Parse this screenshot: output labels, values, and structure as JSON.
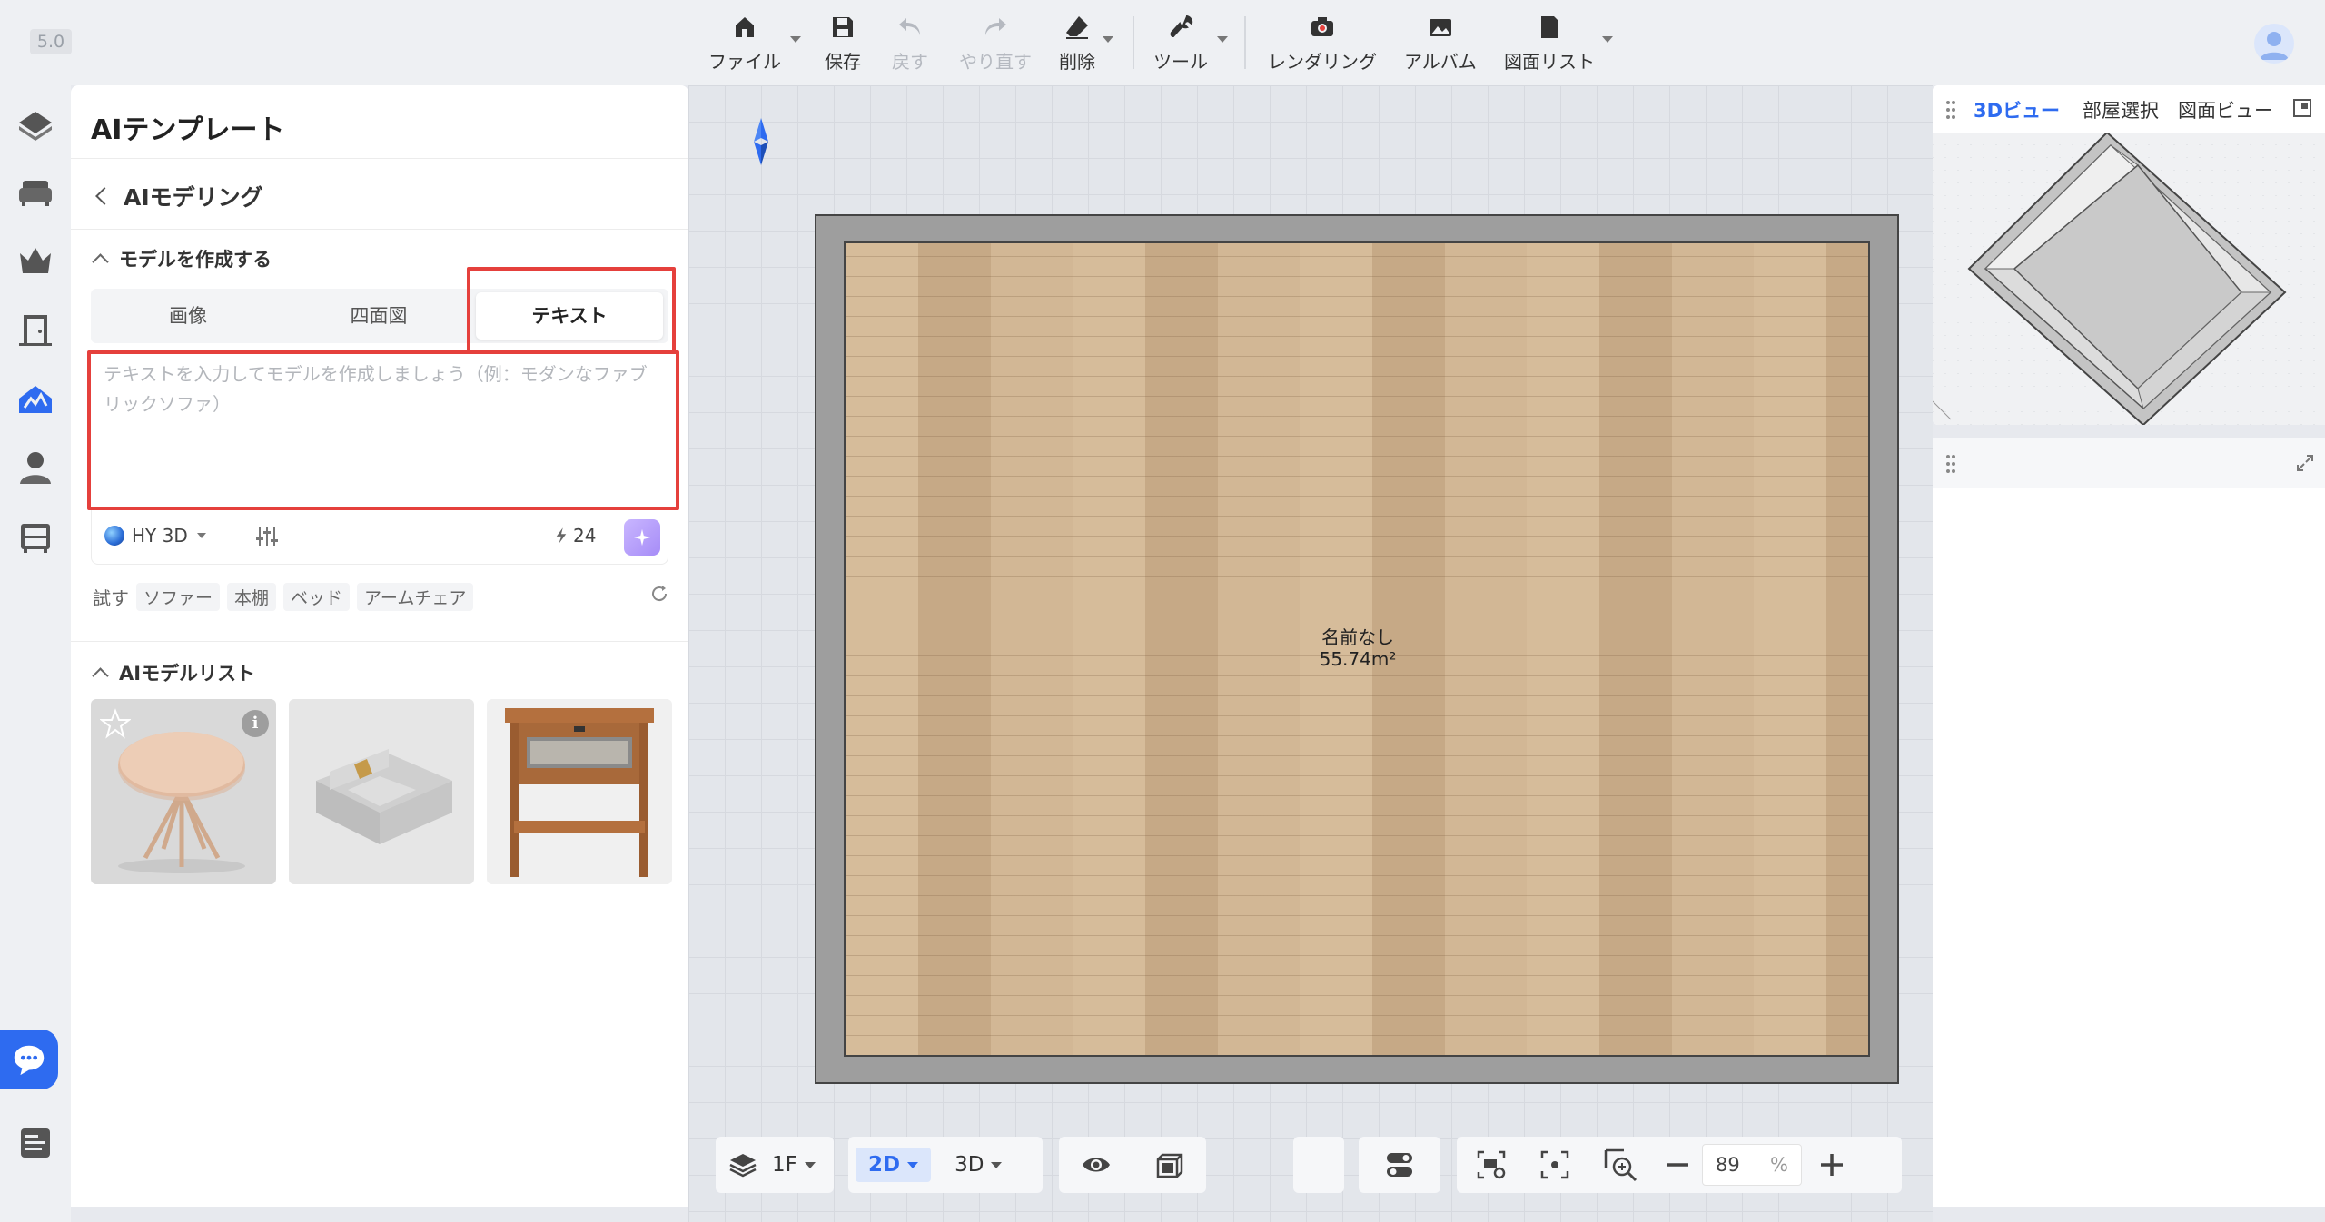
{
  "app": {
    "version": "5.0"
  },
  "toolbar": {
    "items": [
      {
        "label": "ファイル",
        "icon": "home-file-icon",
        "has_dropdown": true
      },
      {
        "label": "保存",
        "icon": "save-icon",
        "has_dropdown": false
      },
      {
        "label": "戻す",
        "icon": "undo-icon",
        "has_dropdown": false,
        "disabled": true
      },
      {
        "label": "やり直す",
        "icon": "redo-icon",
        "has_dropdown": false,
        "disabled": true
      },
      {
        "label": "削除",
        "icon": "eraser-icon",
        "has_dropdown": true
      },
      {
        "label": "ツール",
        "icon": "wrench-icon",
        "has_dropdown": true
      },
      {
        "label": "レンダリング",
        "icon": "camera-icon",
        "has_dropdown": false
      },
      {
        "label": "アルバム",
        "icon": "album-icon",
        "has_dropdown": false
      },
      {
        "label": "図面リスト",
        "icon": "document-list-icon",
        "has_dropdown": true
      }
    ]
  },
  "rail": {
    "items": [
      "house-icon",
      "sofa-icon",
      "crown-icon",
      "door-icon",
      "ai-modeling-icon",
      "user-icon",
      "cabinet-icon"
    ],
    "active_index": 4
  },
  "panel": {
    "title": "AIテンプレート",
    "back_label": "AIモデリング",
    "create_section": "モデルを作成する",
    "tabs": [
      "画像",
      "四面図",
      "テキスト"
    ],
    "active_tab": 2,
    "prompt_placeholder": "テキストを入力してモデルを作成しましょう（例：モダンなファブリックソファ）",
    "model_name": "HY 3D",
    "credits": "24",
    "try_label": "試す",
    "suggestions": [
      "ソファー",
      "本棚",
      "ベッド",
      "アームチェア"
    ],
    "list_section": "AIモデルリスト",
    "models": [
      "round-table",
      "sofa",
      "nightstand"
    ]
  },
  "canvas": {
    "room_name": "名前なし",
    "room_area": "55.74m²"
  },
  "bottom": {
    "floor": "1F",
    "view_2d": "2D",
    "view_3d": "3D",
    "zoom": "89",
    "zoom_unit": "%"
  },
  "right_panel": {
    "tabs": [
      "3Dビュー",
      "部屋選択",
      "図面ビュー"
    ],
    "active_tab": 0
  },
  "colors": {
    "accent": "#2e6bf0",
    "highlight_box": "#e5403c"
  }
}
